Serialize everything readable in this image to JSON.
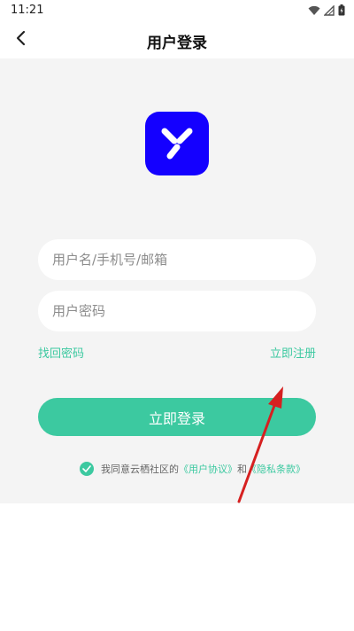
{
  "status_bar": {
    "time": "11:21",
    "icons": [
      "wifi-icon",
      "signal-icon",
      "battery-icon"
    ]
  },
  "nav": {
    "back_icon": "chevron-left-icon",
    "title": "用户登录"
  },
  "logo": {
    "color": "#1400ff"
  },
  "form": {
    "username_placeholder": "用户名/手机号/邮箱",
    "password_placeholder": "用户密码",
    "forgot_label": "找回密码",
    "register_label": "立即注册",
    "login_label": "立即登录"
  },
  "agreement": {
    "checked": true,
    "prefix": "我同意云栖社区的",
    "user_agreement": "《用户协议》",
    "conjunction": "和",
    "privacy_policy": "《隐私条款》"
  },
  "colors": {
    "accent": "#3cc9a0",
    "annotation_arrow": "#d62020"
  }
}
